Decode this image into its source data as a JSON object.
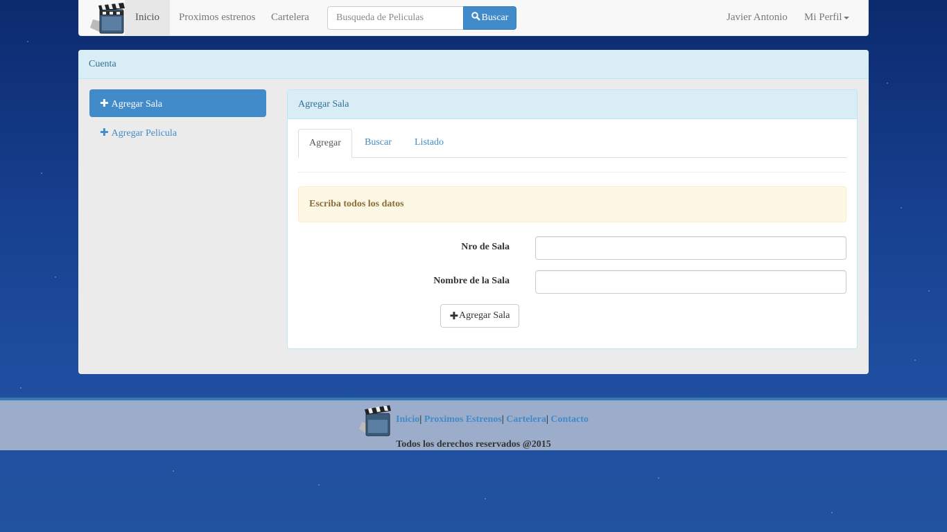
{
  "navbar": {
    "brand_icon": "clapperboard-icon",
    "items": [
      {
        "label": "Inicio"
      },
      {
        "label": "Proximos estrenos"
      },
      {
        "label": "Cartelera"
      }
    ],
    "search": {
      "placeholder": "Busqueda de Peliculas",
      "button_label": "Buscar"
    },
    "user_name": "Javier Antonio",
    "profile_label": "Mi Perfil"
  },
  "panel": {
    "title": "Cuenta",
    "sidebar": {
      "items": [
        {
          "label": "Agregar Sala",
          "active": true
        },
        {
          "label": "Agregar Pelicula",
          "active": false
        }
      ]
    },
    "inner": {
      "title": "Agregar Sala",
      "tabs": [
        {
          "label": "Agregar"
        },
        {
          "label": "Buscar"
        },
        {
          "label": "Listado"
        }
      ],
      "alert": "Escriba todos los datos",
      "fields": [
        {
          "label": "Nro de Sala",
          "value": ""
        },
        {
          "label": "Nombre de la Sala",
          "value": ""
        }
      ],
      "submit_label": "Agregar Sala"
    }
  },
  "footer": {
    "links": [
      "Inicio",
      "Proximos Estrenos",
      "Cartelera",
      "Contacto"
    ],
    "copyright": "Todos los derechos reservados @2015"
  },
  "colors": {
    "primary": "#428bca",
    "info_bg": "#d9edf7",
    "info_text": "#31708f",
    "warning_bg": "#fcf8e3",
    "warning_text": "#8a6d3b"
  }
}
